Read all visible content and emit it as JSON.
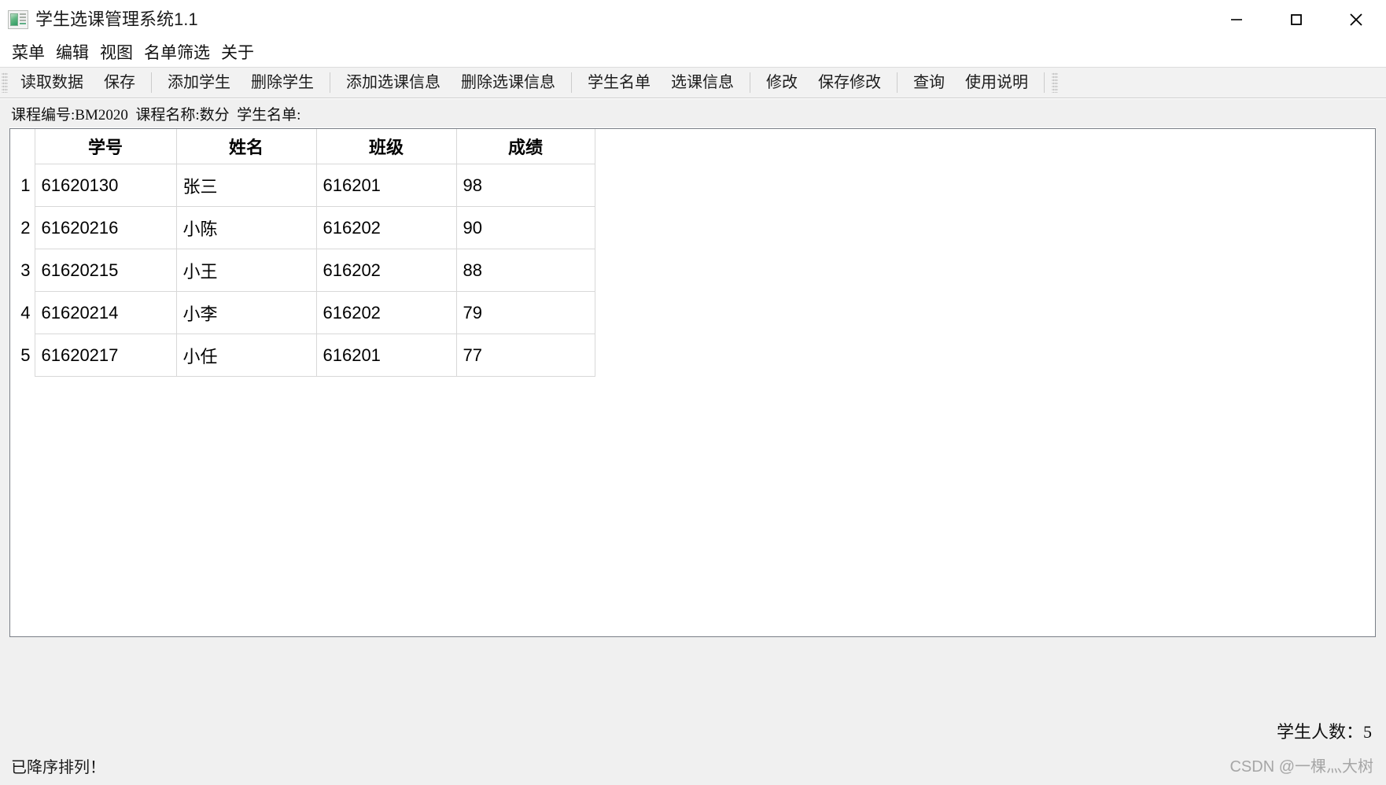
{
  "window": {
    "title": "学生选课管理系统1.1",
    "icon": "app-window-icon",
    "controls": {
      "minimize": "minimize-icon",
      "maximize": "maximize-icon",
      "close": "close-icon"
    }
  },
  "menubar": {
    "items": [
      {
        "label": "菜单"
      },
      {
        "label": "编辑"
      },
      {
        "label": "视图"
      },
      {
        "label": "名单筛选"
      },
      {
        "label": "关于"
      }
    ]
  },
  "toolbar": {
    "groups": [
      {
        "buttons": [
          {
            "label": "读取数据"
          },
          {
            "label": "保存"
          }
        ]
      },
      {
        "buttons": [
          {
            "label": "添加学生"
          },
          {
            "label": "删除学生"
          }
        ]
      },
      {
        "buttons": [
          {
            "label": "添加选课信息"
          },
          {
            "label": "删除选课信息"
          }
        ]
      },
      {
        "buttons": [
          {
            "label": "学生名单"
          },
          {
            "label": "选课信息"
          }
        ]
      },
      {
        "buttons": [
          {
            "label": "修改"
          },
          {
            "label": "保存修改"
          }
        ]
      },
      {
        "buttons": [
          {
            "label": "查询"
          },
          {
            "label": "使用说明"
          }
        ]
      }
    ]
  },
  "info": {
    "text": "课程编号:BM2020  课程名称:数分  学生名单:",
    "course_code_label": "课程编号",
    "course_code": "BM2020",
    "course_name_label": "课程名称",
    "course_name": "数分",
    "roster_label": "学生名单"
  },
  "table": {
    "headers": [
      "学号",
      "姓名",
      "班级",
      "成绩"
    ],
    "rows": [
      {
        "no": "1",
        "id": "61620130",
        "name": "张三",
        "class": "616201",
        "score": "98"
      },
      {
        "no": "2",
        "id": "61620216",
        "name": "小陈",
        "class": "616202",
        "score": "90"
      },
      {
        "no": "3",
        "id": "61620215",
        "name": "小王",
        "class": "616202",
        "score": "88"
      },
      {
        "no": "4",
        "id": "61620214",
        "name": "小李",
        "class": "616202",
        "score": "79"
      },
      {
        "no": "5",
        "id": "61620217",
        "name": "小任",
        "class": "616201",
        "score": "77"
      }
    ]
  },
  "footer": {
    "count_text": "学生人数：5",
    "count_label": "学生人数",
    "count_value": "5",
    "status_text": "已降序排列！",
    "watermark": "CSDN @一棵灬大树"
  },
  "colors": {
    "window_bg": "#ffffff",
    "panel_bg": "#f0f0f0",
    "toolbar_bg": "#f2f2f2",
    "grid_line": "#d8d8d8",
    "panel_border": "#7a7f87",
    "watermark": "#a6a6a6"
  }
}
